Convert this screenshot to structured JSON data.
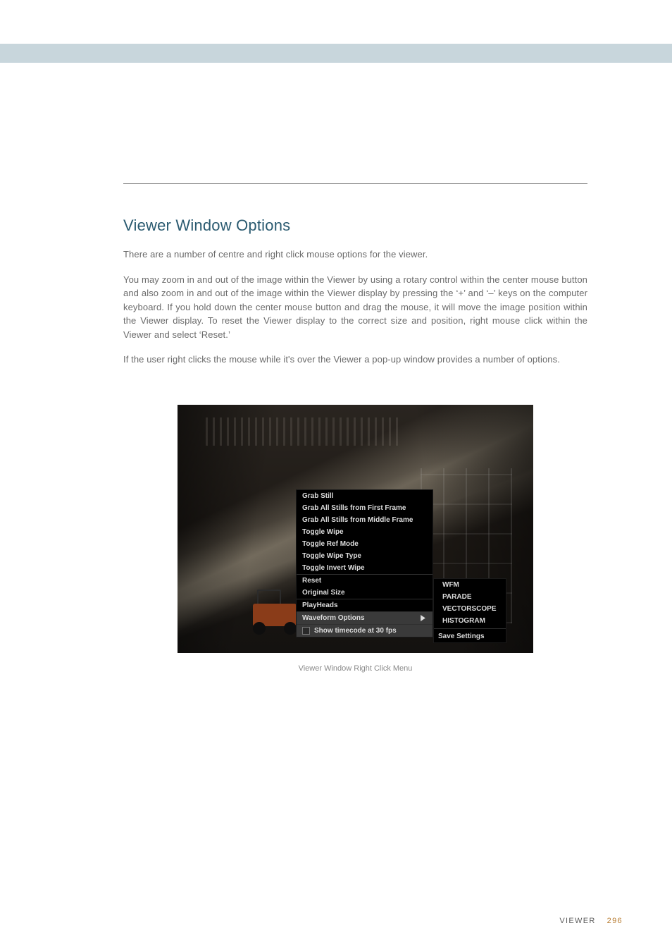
{
  "heading": "Viewer Window Options",
  "paragraphs": {
    "intro": "There are a number of centre and right click mouse options for the viewer.",
    "zoom": "You may zoom in and out of the image within the Viewer by using a rotary control within the center mouse button and also zoom in and out of the image within the Viewer display by pressing the ‘+’ and ‘–’ keys on the computer keyboard. If you hold down the center mouse button and drag the mouse, it will move the image position within the Viewer display. To reset the Viewer display to the correct size and position, right mouse click within the Viewer and select ‘Reset.’",
    "rightclick": "If the user right clicks the mouse while it's over the Viewer a pop-up window provides a number of options."
  },
  "caption": "Viewer Window Right Click Menu",
  "menu": {
    "grab_still": "Grab Still",
    "grab_first": "Grab All Stills from First Frame",
    "grab_middle": "Grab All Stills from Middle Frame",
    "toggle_wipe": "Toggle Wipe",
    "toggle_ref": "Toggle Ref Mode",
    "toggle_wipe_type": "Toggle Wipe Type",
    "toggle_invert": "Toggle Invert Wipe",
    "reset": "Reset",
    "orig_size": "Original Size",
    "playheads": "PlayHeads",
    "waveform": "Waveform Options",
    "show_tc": "Show timecode at 30 fps"
  },
  "submenu": {
    "wfm": "WFM",
    "parade": "PARADE",
    "vectorscope": "VECTORSCOPE",
    "histogram": "HISTOGRAM",
    "save": "Save Settings"
  },
  "footer": {
    "section": "VIEWER",
    "page": "296"
  }
}
